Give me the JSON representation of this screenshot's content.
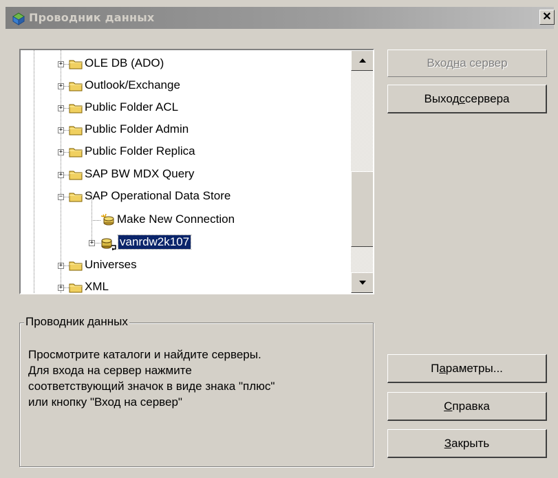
{
  "window": {
    "title": "Проводник данных",
    "close_label": "✕"
  },
  "tree": {
    "items": [
      {
        "label": "OLE DB (ADO)",
        "expander": "+",
        "type": "folder"
      },
      {
        "label": "Outlook/Exchange",
        "expander": "+",
        "type": "folder"
      },
      {
        "label": "Public Folder ACL",
        "expander": "+",
        "type": "folder"
      },
      {
        "label": "Public Folder Admin",
        "expander": "+",
        "type": "folder"
      },
      {
        "label": "Public Folder Replica",
        "expander": "+",
        "type": "folder"
      },
      {
        "label": "SAP BW MDX Query",
        "expander": "+",
        "type": "folder"
      },
      {
        "label": "SAP Operational Data Store",
        "expander": "−",
        "type": "folder"
      },
      {
        "label": "Make New Connection",
        "type": "new-connection"
      },
      {
        "label": "vanrdw2k107",
        "expander": "+",
        "type": "server",
        "selected": true
      },
      {
        "label": "Universes",
        "expander": "+",
        "type": "folder"
      },
      {
        "label": "XML",
        "expander": "+",
        "type": "folder"
      }
    ]
  },
  "buttons": {
    "login": {
      "pre": "Вход ",
      "accel": "н",
      "post": "а сервер",
      "enabled": false
    },
    "logout": {
      "pre": "Выход ",
      "accel": "с",
      "post": " сервера",
      "enabled": true
    },
    "options": {
      "pre": "П",
      "accel": "а",
      "post": "раметры...",
      "enabled": true
    },
    "help": {
      "pre": "",
      "accel": "С",
      "post": "правка",
      "enabled": true
    },
    "close": {
      "pre": "",
      "accel": "З",
      "post": "акрыть",
      "enabled": true
    }
  },
  "info": {
    "title": "Проводник данных",
    "lines": [
      "Просмотрите каталоги и найдите серверы.",
      "Для входа на сервер нажмите",
      "соответствующий значок в виде знака \"плюс\"",
      "или кнопку \"Вход на сервер\""
    ]
  },
  "colors": {
    "face": "#d4d0c8",
    "selection": "#0a246a",
    "folder": "#f0d060"
  }
}
